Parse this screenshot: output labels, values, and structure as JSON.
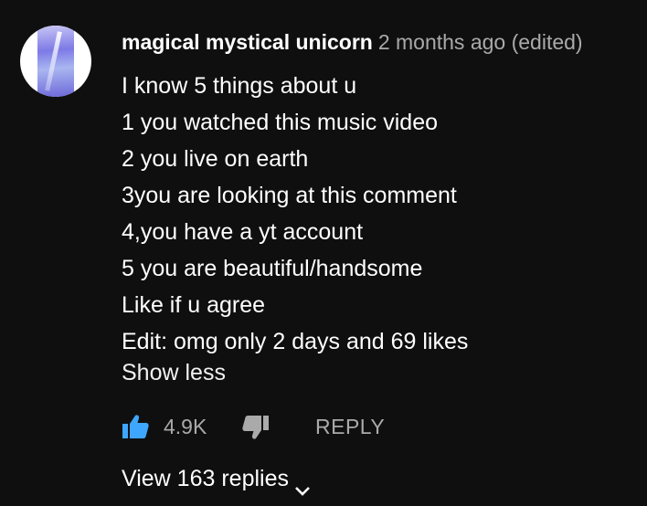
{
  "comment": {
    "author": "magical mystical unicorn",
    "time": "2 months ago (edited)",
    "lines": [
      "I know 5 things about u",
      "1 you watched this music video",
      "2 you live on earth",
      "3you are looking at this comment",
      "4,you have a yt account",
      "5 you are beautiful/handsome",
      "Like if u agree",
      "Edit: omg only 2 days and 69 likes"
    ],
    "show_less_label": "Show less",
    "like_count": "4.9K",
    "reply_label": "REPLY",
    "view_replies_label": "View 163 replies"
  },
  "icons": {
    "avatar": "avatar-image",
    "like": "thumbs-up-icon",
    "dislike": "thumbs-down-icon",
    "expand": "chevron-down-icon"
  },
  "colors": {
    "background": "#0f0f0f",
    "like_active": "#3ea6ff",
    "secondary_text": "#aaaaaa"
  }
}
